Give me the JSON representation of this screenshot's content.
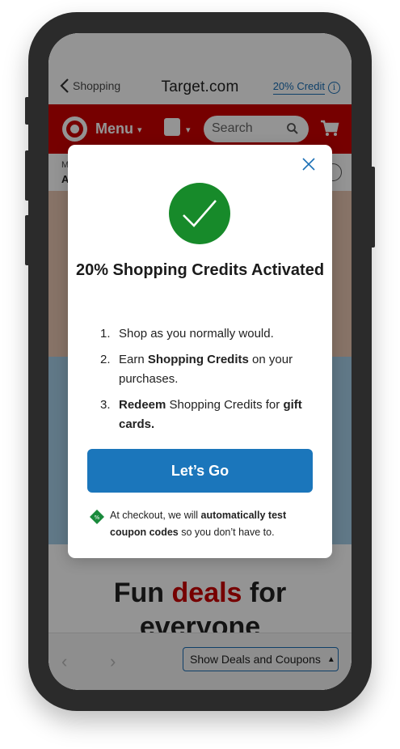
{
  "browser": {
    "back_label": "Shopping",
    "site_title": "Target.com",
    "credit_label": "20% Credit",
    "info_icon": "i"
  },
  "target_nav": {
    "menu_label": "Menu",
    "search_placeholder": "Search"
  },
  "subheader": {
    "line1": "M",
    "line2": "A"
  },
  "page": {
    "headline_1": "Fun ",
    "headline_deals": "deals",
    "headline_2": " for",
    "headline_3": "everyone"
  },
  "bottom_bar": {
    "show_deals_label": "Show Deals and Coupons"
  },
  "modal": {
    "title": "20% Shopping Credits Activated",
    "steps": [
      {
        "num": "1.",
        "text": "Shop as you normally would."
      },
      {
        "num": "2.",
        "pre": "Earn ",
        "bold": "Shopping Credits",
        "post": " on your purchases."
      },
      {
        "num": "3.",
        "bold": "Redeem",
        "post": " Shopping Credits for ",
        "bold2": "gift cards."
      }
    ],
    "cta_label": "Let’s Go",
    "note_pre": "At checkout, we will ",
    "note_bold": "automatically test coupon codes",
    "note_post": " so you don’t have to."
  },
  "colors": {
    "target_red": "#cc0000",
    "primary_blue": "#1b76bb",
    "success_green": "#178a2a"
  }
}
